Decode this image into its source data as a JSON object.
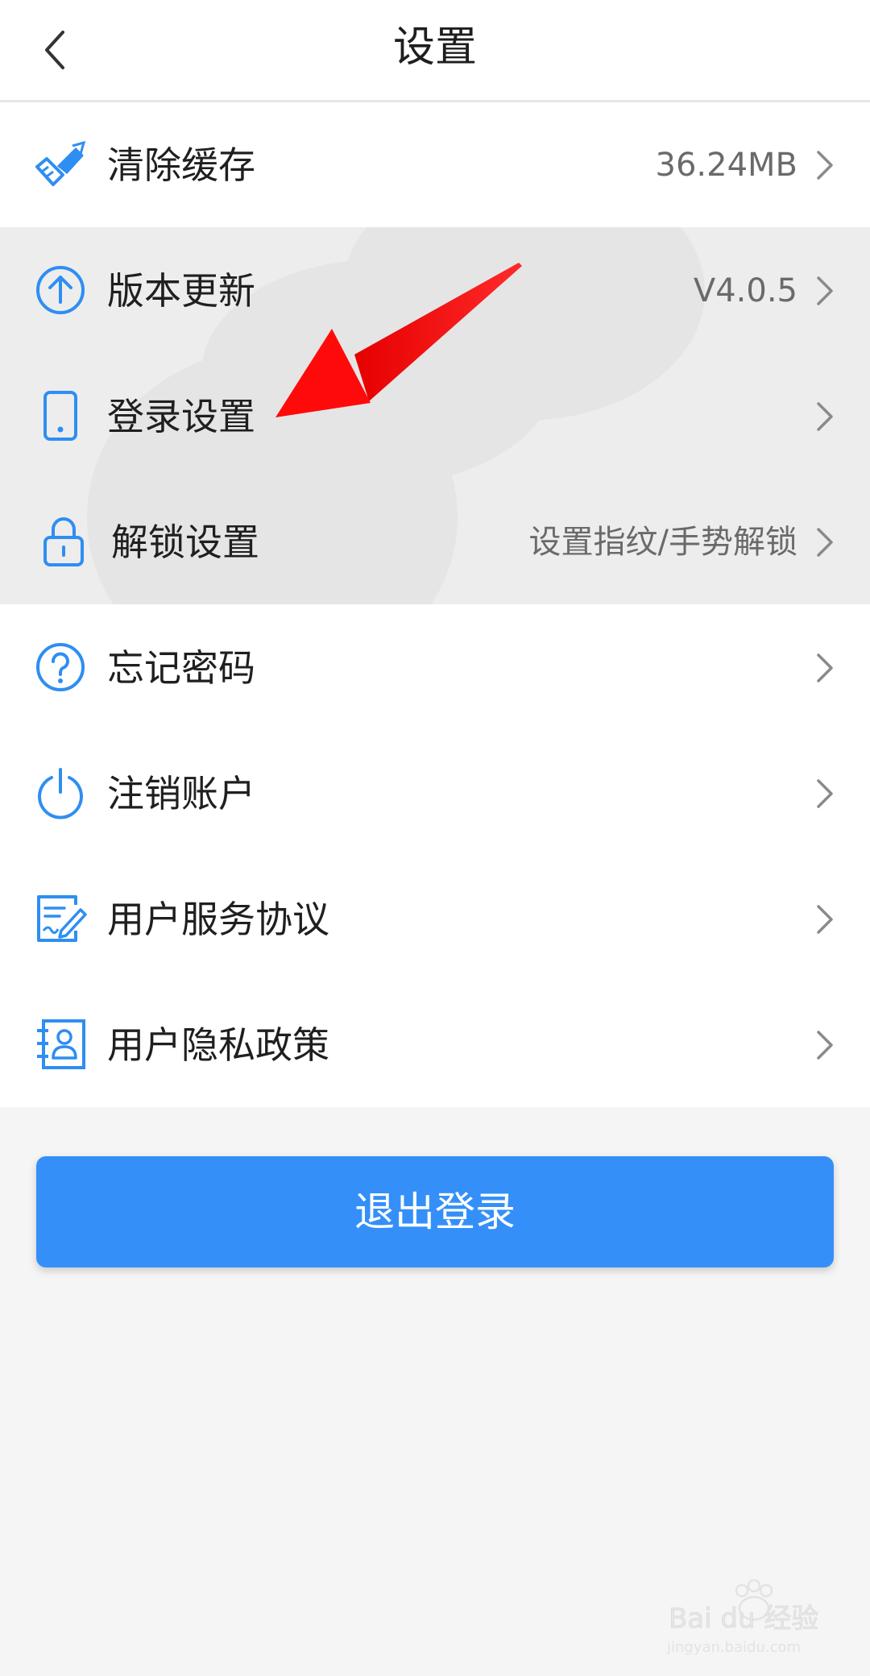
{
  "header": {
    "title": "设置"
  },
  "settings": {
    "items": [
      {
        "label": "清除缓存",
        "value": "36.24MB",
        "icon": "brush-icon"
      },
      {
        "label": "版本更新",
        "value": "V4.0.5",
        "icon": "upload-circle-icon"
      },
      {
        "label": "登录设置",
        "value": "",
        "icon": "phone-icon"
      },
      {
        "label": "解锁设置",
        "value": "设置指纹/手势解锁",
        "icon": "lock-icon"
      },
      {
        "label": "忘记密码",
        "value": "",
        "icon": "question-circle-icon"
      },
      {
        "label": "注销账户",
        "value": "",
        "icon": "power-icon"
      },
      {
        "label": "用户服务协议",
        "value": "",
        "icon": "document-sign-icon"
      },
      {
        "label": "用户隐私政策",
        "value": "",
        "icon": "user-card-icon"
      }
    ]
  },
  "logout": {
    "label": "退出登录"
  },
  "colors": {
    "accent": "#3490f8",
    "icon": "#2e8ef2",
    "annotation_arrow": "#ff0000"
  },
  "watermark": {
    "brand": "Bai du 经验",
    "url": "jingyan.baidu.com"
  }
}
